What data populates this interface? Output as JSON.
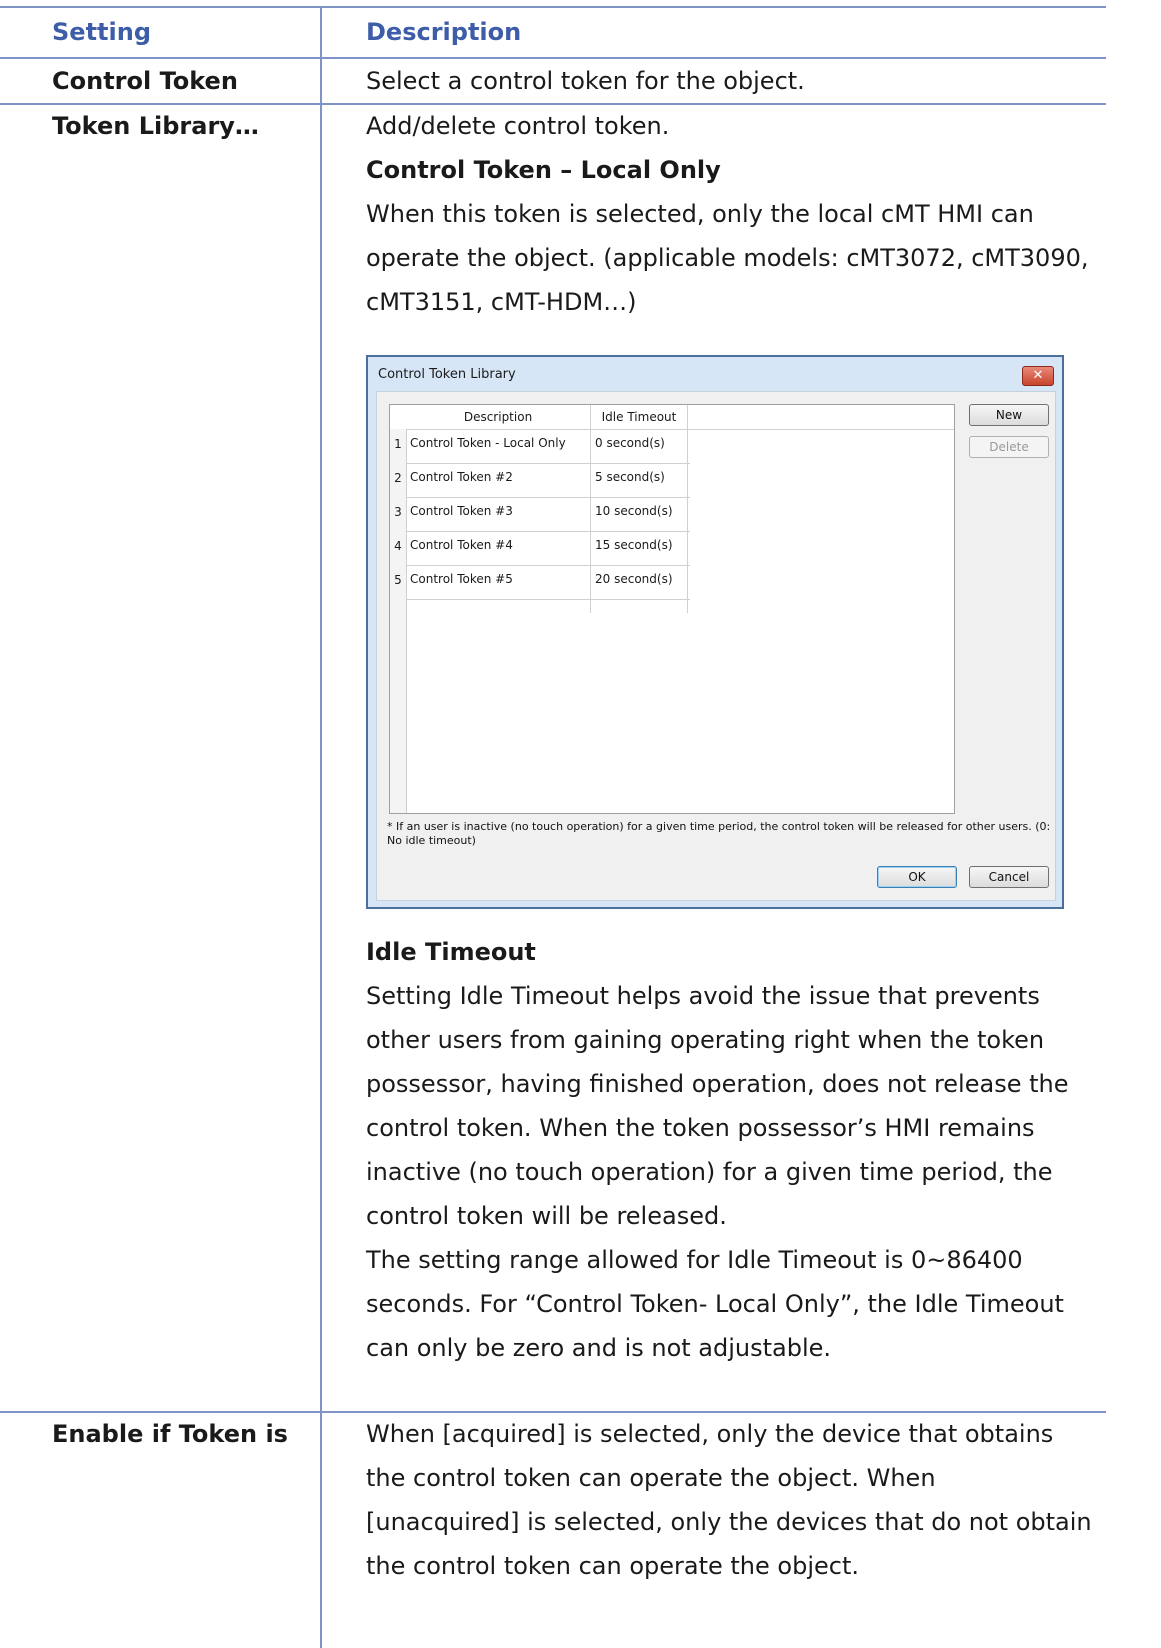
{
  "table": {
    "header": {
      "setting": "Setting",
      "description": "Description"
    },
    "rows": {
      "control_token": {
        "setting": "Control Token",
        "description": "Select a control token for the object."
      },
      "token_library": {
        "setting": "Token Library…",
        "line1": "Add/delete control token.",
        "subheading1": "Control Token – Local Only",
        "para1": "When this token is selected, only the local cMT HMI can operate the object. (applicable models: cMT3072, cMT3090, cMT3151, cMT-HDM…)",
        "subheading2": "Idle Timeout",
        "para2": "Setting Idle Timeout helps avoid the issue that prevents other users from gaining operating right when the token possessor, having finished operation, does not release the control token. When the token possessor’s HMI remains inactive (no touch operation) for a given time period, the control token will be released.",
        "para3": "The setting range allowed for Idle Timeout is 0~86400 seconds. For “Control Token- Local Only”, the Idle Timeout can only be zero and is not adjustable."
      },
      "enable_if": {
        "setting": "Enable if Token is",
        "description": "When [acquired] is selected, only the device that obtains the control token can operate the object. When [unacquired] is selected, only the devices that do not obtain the control token can operate the object."
      }
    }
  },
  "dialog": {
    "title": "Control Token Library",
    "close_glyph": "✕",
    "columns": {
      "description": "Description",
      "idle_timeout": "Idle Timeout"
    },
    "rows": [
      {
        "num": "1",
        "description": "Control Token - Local Only",
        "timeout": "0 second(s)"
      },
      {
        "num": "2",
        "description": "Control Token #2",
        "timeout": "5 second(s)"
      },
      {
        "num": "3",
        "description": "Control Token #3",
        "timeout": "10 second(s)"
      },
      {
        "num": "4",
        "description": "Control Token #4",
        "timeout": "15 second(s)"
      },
      {
        "num": "5",
        "description": "Control Token #5",
        "timeout": "20 second(s)"
      }
    ],
    "buttons": {
      "new": "New",
      "delete": "Delete",
      "ok": "OK",
      "cancel": "Cancel"
    },
    "note": "* If an user is inactive (no touch operation) for a given time period, the control token will be released for other users. (0: No idle timeout)"
  }
}
